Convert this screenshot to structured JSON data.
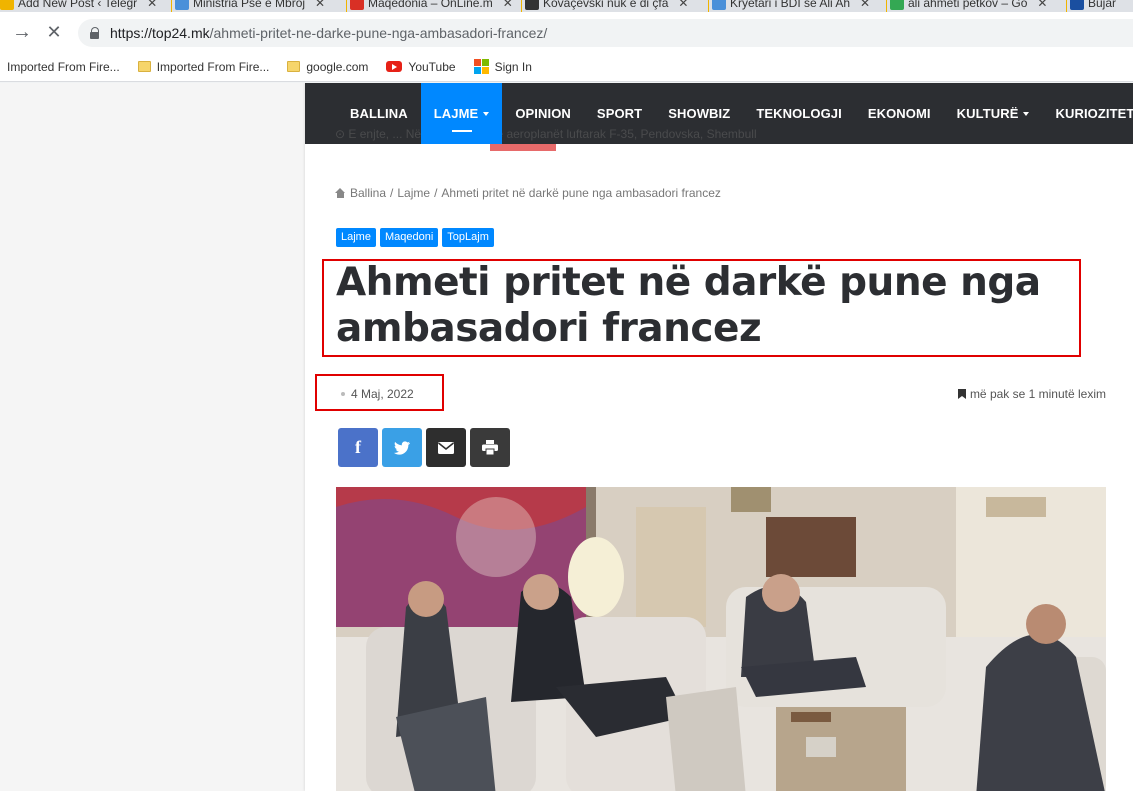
{
  "browser": {
    "tabs": [
      {
        "title": "Add New Post ‹ Telegr",
        "color": "#f0b400"
      },
      {
        "title": "Ministria Pse e Mbroj",
        "color": "#4a90d9"
      },
      {
        "title": "Maqedonia – OnLine.m",
        "color": "#d93025"
      },
      {
        "title": "Kovaçevski nuk e di çfa",
        "color": "#333333"
      },
      {
        "title": "Kryetari i BDI se Ali Ah",
        "color": "#4a90d9"
      },
      {
        "title": "ali ahmeti petkov – Go",
        "color": "#34a853"
      },
      {
        "title": "Bujar",
        "color": "#1a4fa0"
      }
    ],
    "url_host": "https://top24.mk",
    "url_path": "/ahmeti-pritet-ne-darke-pune-nga-ambasadori-francez/",
    "bookmarks": [
      {
        "label": "Imported From Fire...",
        "icon": "folder-icon"
      },
      {
        "label": "Imported From Fire...",
        "icon": "folder-icon"
      },
      {
        "label": "google.com",
        "icon": "folder-icon"
      },
      {
        "label": "YouTube",
        "icon": "youtube-icon"
      },
      {
        "label": "Sign In",
        "icon": "microsoft-icon"
      }
    ]
  },
  "site": {
    "nav": [
      {
        "label": "BALLINA",
        "active": false,
        "dropdown": false
      },
      {
        "label": "LAJME",
        "active": true,
        "dropdown": true
      },
      {
        "label": "OPINION",
        "active": false,
        "dropdown": false
      },
      {
        "label": "SPORT",
        "active": false,
        "dropdown": false
      },
      {
        "label": "SHOWBIZ",
        "active": false,
        "dropdown": false
      },
      {
        "label": "TEKNOLOGJI",
        "active": false,
        "dropdown": false
      },
      {
        "label": "EKONOMI",
        "active": false,
        "dropdown": false
      },
      {
        "label": "KULTURË",
        "active": false,
        "dropdown": true
      },
      {
        "label": "KURIOZITETE",
        "active": false,
        "dropdown": false
      }
    ],
    "ticker": "⊙ E enjte, ...      Në Shkup stërvitje aeroplanët luftarak F-35, Pendovska, Shembull",
    "accent": "#0088ff"
  },
  "article": {
    "breadcrumb": [
      "Ballina",
      "Lajme",
      "Ahmeti pritet në darkë pune nga ambasadori francez"
    ],
    "tags": [
      "Lajme",
      "Maqedoni",
      "TopLajm"
    ],
    "title": "Ahmeti pritet në darkë pune nga ambasadori francez",
    "date": "4 Maj, 2022",
    "read_time": "më pak se 1 minutë lexim",
    "share": [
      {
        "icon": "facebook-icon",
        "glyph": "f"
      },
      {
        "icon": "twitter-icon",
        "glyph": "✦"
      },
      {
        "icon": "email-icon",
        "glyph": "✉"
      },
      {
        "icon": "print-icon",
        "glyph": "⎙"
      }
    ]
  }
}
